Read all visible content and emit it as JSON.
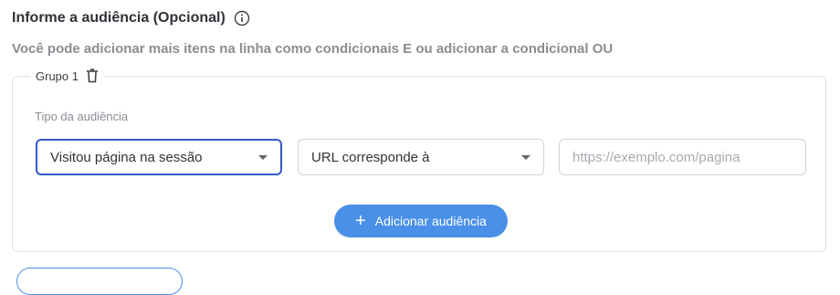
{
  "section": {
    "title": "Informe a audiência (Opcional)",
    "subtitle": "Você pode adicionar mais itens na linha como condicionais E ou adicionar a condicional OU"
  },
  "group": {
    "label": "Grupo 1",
    "field_label": "Tipo da audiência",
    "audience_type_select": "Visitou página na sessão",
    "condition_select": "URL corresponde à",
    "url_placeholder": "https://exemplo.com/pagina",
    "url_value": ""
  },
  "actions": {
    "add_audience": "Adicionar audiência"
  },
  "icons": {
    "info": "info-icon",
    "trash": "trash-icon",
    "plus": "plus-icon",
    "dropdown": "chevron-down-icon"
  },
  "colors": {
    "primary": "#4a90e8",
    "focus_border": "#3659c9",
    "border": "#cfd3d8",
    "title_text": "#2f3338",
    "subtitle_text": "#8a8d92"
  }
}
